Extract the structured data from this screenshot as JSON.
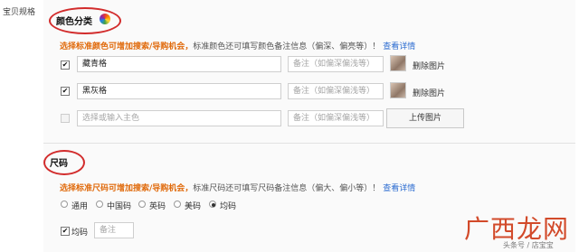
{
  "left_label": "宝贝规格",
  "color_section": {
    "title": "颜色分类",
    "hint_strong": "选择标准颜色可增加搜索/导购机会，",
    "hint_text": "标准颜色还可填写颜色备注信息（偏深、偏亮等）！",
    "hint_link": "查看详情",
    "rows": [
      {
        "checked": true,
        "name": "藏青格",
        "note_placeholder": "备注（如偏深偏浅等）",
        "delete_label": "删除图片"
      },
      {
        "checked": true,
        "name": "黑灰格",
        "note_placeholder": "备注（如偏深偏浅等）",
        "delete_label": "删除图片"
      }
    ],
    "new_row": {
      "name_placeholder": "选择或输入主色",
      "note_placeholder": "备注（如偏深偏浅等）",
      "upload_label": "上传图片"
    }
  },
  "size_section": {
    "title": "尺码",
    "hint_strong": "选择标准尺码可增加搜索/导购机会，",
    "hint_text": "标准尺码还可填写尺码备注信息（偏大、偏小等）！",
    "hint_link": "查看详情",
    "options": [
      "通用",
      "中国码",
      "英码",
      "美码",
      "均码"
    ],
    "selected_option": "均码",
    "size_row": {
      "checked": true,
      "label": "均码",
      "note_placeholder": "备注"
    }
  },
  "watermark": {
    "text": "广西龙网",
    "sub": "头条号 / 店宝宝"
  }
}
